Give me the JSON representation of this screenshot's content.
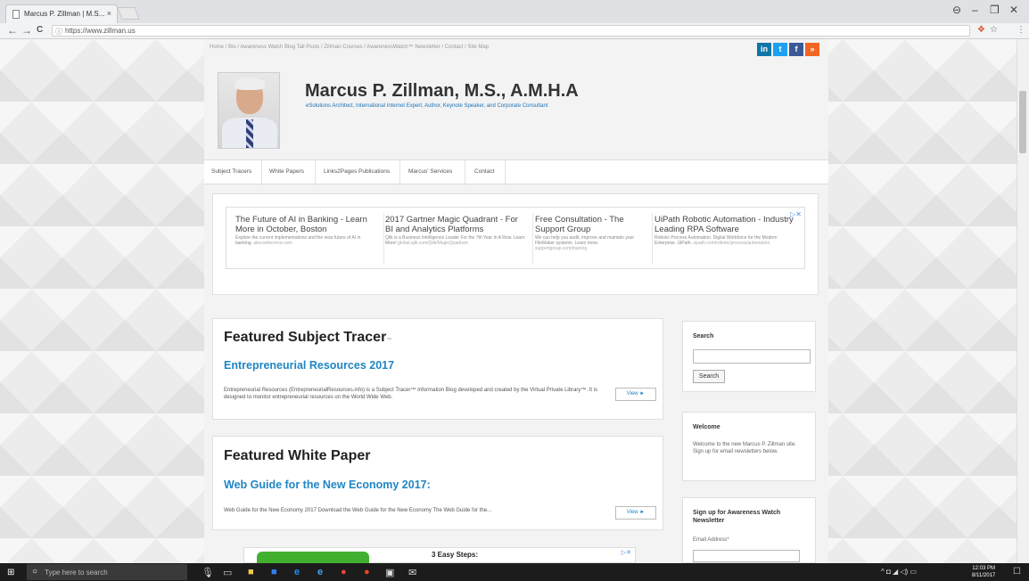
{
  "browser": {
    "tab_title": "Marcus P. Zillman | M.S...",
    "tab_close": "×",
    "url": "https://www.zillman.us",
    "back": "←",
    "forward": "→",
    "reload": "C",
    "info": "ⓘ",
    "window_user": "⊖",
    "window_min": "–",
    "window_max": "❐",
    "window_close": "✕",
    "star": "☆",
    "menu": "⋮",
    "ext": "❖"
  },
  "site": {
    "top_nav": "Home / Bio / Awareness Watch Blog Tall Posts / Zillman Courses / AwarenessWatch™ Newsletter / Contact / Site Map",
    "social": {
      "linkedin": "in",
      "twitter": "t",
      "facebook": "f",
      "rss": "»"
    },
    "title": "Marcus P. Zillman, M.S., A.M.H.A",
    "tagline": "eSolutions Architect, International Internet Expert, Author, Keynote Speaker, and Corporate Consultant",
    "nav": [
      "Subject Tracers",
      "White Papers",
      "Links2Pages Publications",
      "Marcus' Services",
      "Contact"
    ],
    "ads": [
      {
        "headline": "The Future of AI in Banking - Learn More in October, Boston",
        "desc": "Explore the current implementations and the near future of AI in banking.",
        "url": "aiinconference.com"
      },
      {
        "headline": "2017 Gartner Magic Quadrant - For BI and Analytics Platforms",
        "desc": "Qlik is a Business Intelligence Leader For the 7th Year In A Row. Learn More!",
        "url": "global.qlik.com/Qlik/MagicQuadrant"
      },
      {
        "headline": "Free Consultation - The Support Group",
        "desc": "We can help you audit, improve and maintain your FileMaker systems. Learn more.",
        "url": "supportgroup.com/training"
      },
      {
        "headline": "UiPath Robotic Automation - Industry Leading RPA Software",
        "desc": "Robotic Process Automation. Digital Workforce for the Modern Enterprise. UiPath.",
        "url": "uipath.com/robotic/process/automation"
      }
    ],
    "adchoices": "▷✕",
    "featured_tracer": {
      "heading": "Featured Subject Tracer",
      "tm": "™",
      "title": "Entrepreneurial Resources 2017",
      "body": "Entrepreneurial Resources (EntrepreneurialResources.info) is a Subject Tracer™ Information Blog developed and created by the Virtual Private Library™. It is designed to monitor entrepreneurial resources on the World Wide Web.",
      "view": "View ►"
    },
    "featured_paper": {
      "heading": "Featured White Paper",
      "title": "Web Guide for the New Economy 2017:",
      "body": "Web Guide for the New Economy 2017 Download the Web Guide for the New Economy The Web Guide for the...",
      "view": "View ►"
    },
    "sidebar": {
      "search_title": "Search",
      "search_button": "Search",
      "welcome_title": "Welcome",
      "welcome_text": "Welcome to the new Marcus P. Zillman site. Sign up for email newsletters below.",
      "signup_title": "Sign up for Awareness Watch Newsletter",
      "email_label": "Email Address*"
    },
    "bottom_ad": {
      "text": "3 Easy Steps:",
      "choices": "▷✕"
    }
  },
  "taskbar": {
    "start": "⊞",
    "search_placeholder": "Type here to search",
    "search_icon": "○",
    "time": "12:03 PM",
    "date": "8/11/2017",
    "tray": "^  ◘  ◢  ◁)  ▭"
  },
  "colors": {
    "link_blue": "#1f86c4",
    "linkedin": "#0e76a8",
    "twitter": "#1da1f2",
    "facebook": "#3b5998",
    "rss": "#f26522"
  }
}
